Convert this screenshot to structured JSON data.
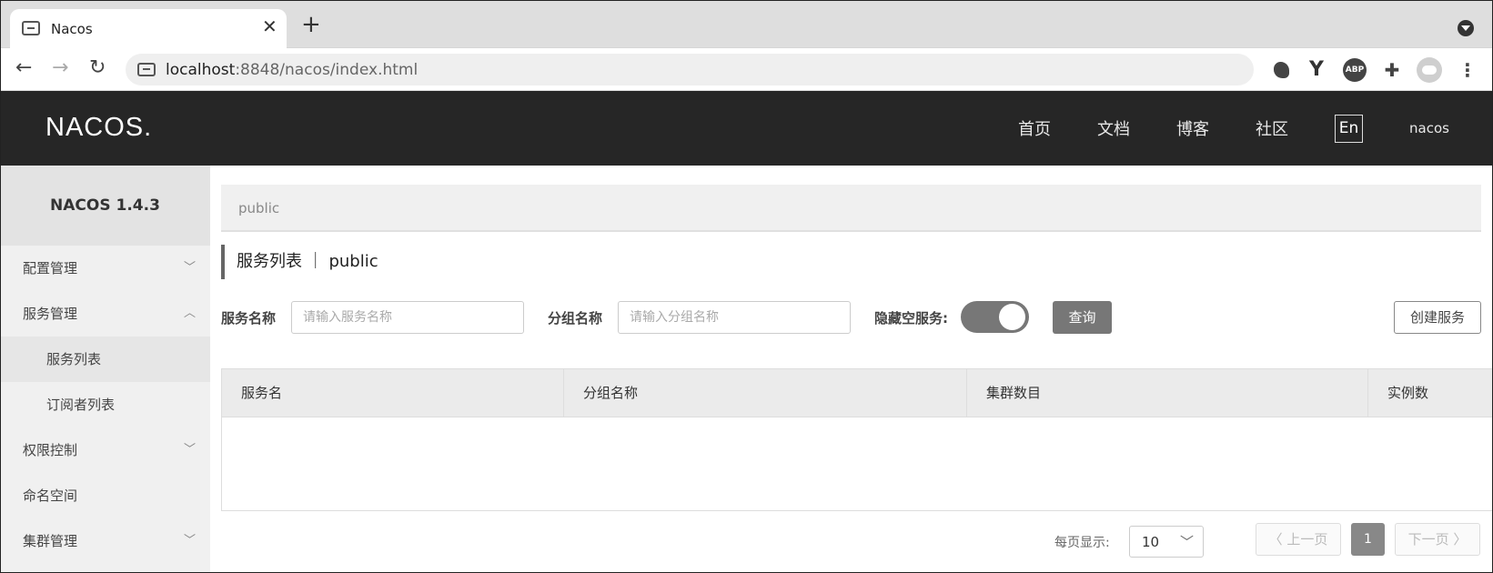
{
  "browser": {
    "tab_title": "Nacos",
    "tab_close": "✕",
    "new_tab": "+",
    "url_host": "localhost",
    "url_rest": ":8848/nacos/index.html",
    "back": "←",
    "forward": "→",
    "reload": "↻",
    "ext_y": "Y",
    "ext_abp": "ABP",
    "ext_puzzle": "✚",
    "menu": "⋮"
  },
  "header": {
    "logo": "NACOS.",
    "nav": [
      "首页",
      "文档",
      "博客",
      "社区"
    ],
    "lang": "En",
    "user": "nacos"
  },
  "sidebar": {
    "version": "NACOS 1.4.3",
    "items": [
      {
        "label": "配置管理",
        "chevron": "﹀"
      },
      {
        "label": "服务管理",
        "chevron": "︿"
      },
      {
        "label": "服务列表"
      },
      {
        "label": "订阅者列表"
      },
      {
        "label": "权限控制",
        "chevron": "﹀"
      },
      {
        "label": "命名空间"
      },
      {
        "label": "集群管理",
        "chevron": "﹀"
      }
    ]
  },
  "main": {
    "namespace": "public",
    "title": "服务列表 ｜ public",
    "filters": {
      "service_label": "服务名称",
      "service_placeholder": "请输入服务名称",
      "group_label": "分组名称",
      "group_placeholder": "请输入分组名称",
      "hide_empty_label": "隐藏空服务:",
      "hide_empty_on": true,
      "query_button": "查询",
      "create_button": "创建服务"
    },
    "table": {
      "columns": [
        "服务名",
        "分组名称",
        "集群数目",
        "实例数"
      ],
      "rows": []
    },
    "pagination": {
      "page_size_label": "每页显示:",
      "page_size": "10",
      "page_size_chevron": "﹀",
      "prev": "〈 上一页",
      "current_page": "1",
      "next": "下一页 〉"
    }
  }
}
